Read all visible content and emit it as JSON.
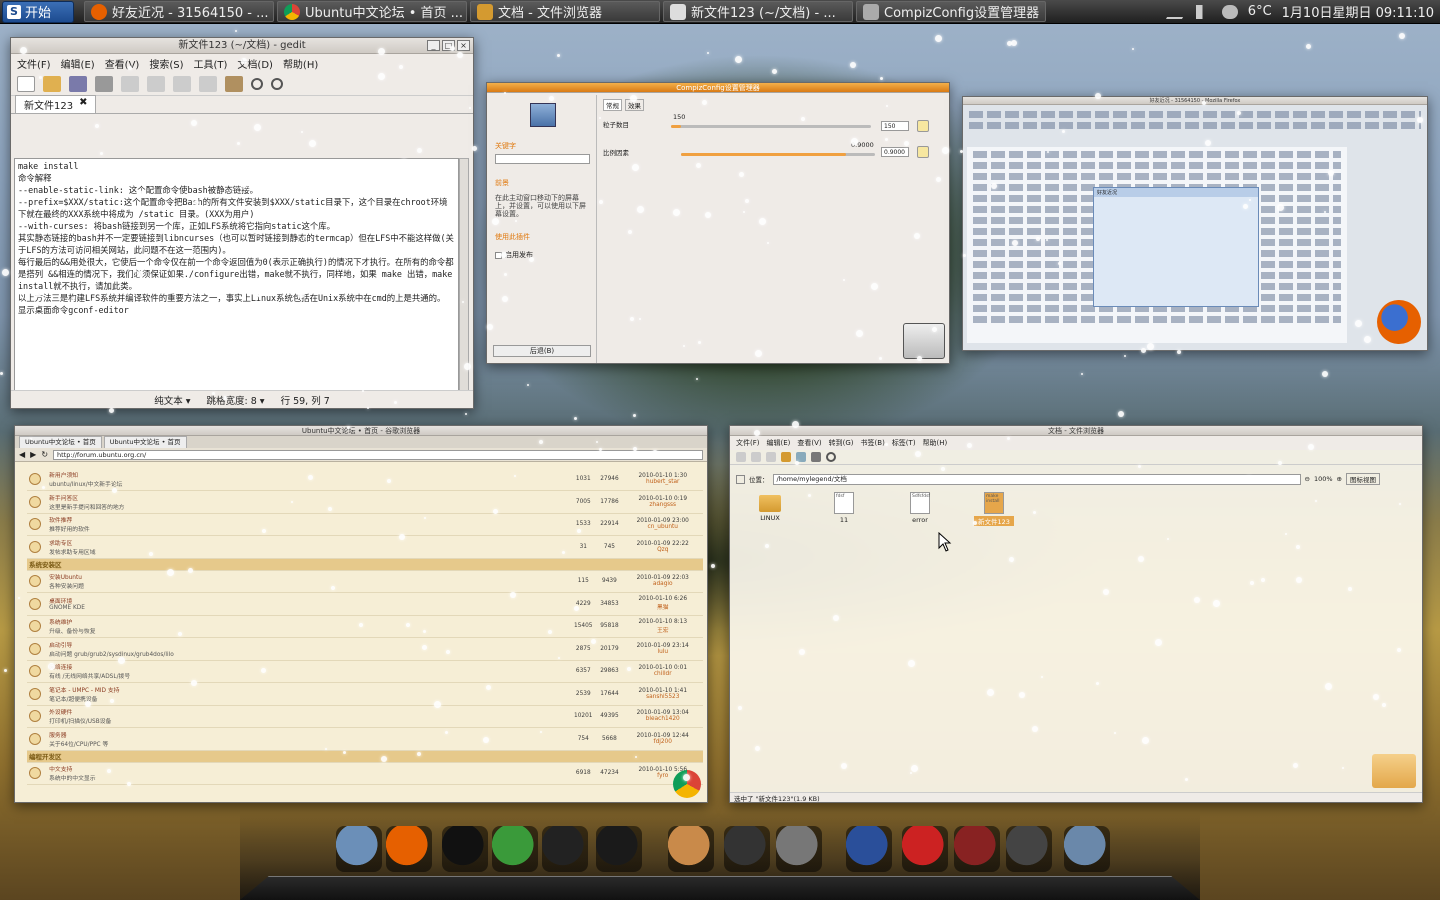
{
  "panel": {
    "start_label": "开始",
    "tasks": [
      {
        "label": "好友近况 - 31564150 - ...",
        "icon": "firefox-icon",
        "color": "#e66000"
      },
      {
        "label": "Ubuntu中文论坛 • 首页 ...",
        "icon": "chrome-icon",
        "color": "#3a8a3a"
      },
      {
        "label": "文档 - 文件浏览器",
        "icon": "folder-icon",
        "color": "#d49a30"
      },
      {
        "label": "新文件123 (~/文档) - ...",
        "icon": "text-editor-icon",
        "color": "#dddddd"
      },
      {
        "label": "CompizConfig设置管理器",
        "icon": "compiz-icon",
        "color": "#aaaaaa"
      }
    ],
    "weather": "6°C",
    "clock": "1月10日星期日 09:11:10"
  },
  "gedit": {
    "title": "新文件123 (~/文档) - gedit",
    "menu": [
      "文件(F)",
      "编辑(E)",
      "查看(V)",
      "搜索(S)",
      "工具(T)",
      "文档(D)",
      "帮助(H)"
    ],
    "tab_label": "新文件123",
    "lines": [
      "make install",
      "",
      "命令解释",
      "",
      "--enable-static-link: 这个配置命令使bash被静态链接。",
      "",
      "--prefix=$XXX/static:这个配置命令把Bash的所有文件安装到$XXX/static目录下，这个目录在chroot环境下就在最终的XXX系统中将成为 /static 目录。(XXX为用户)",
      "",
      "--with-curses: 将bash链接到另一个库，正如LFS系统将它指向static这个库。",
      "",
      "其实静态链接的bash并不一定要链接到libncurses（也可以暂时链接到静态的termcap）但在LFS中不能这样做(关于LFS的方法可访问相关网站，此问题不在这一范围内)。",
      "",
      "每行最后的&&用处很大，它使后一个命令仅在前一个命令返回值为0(表示正确执行)的情况下才执行。在所有的命令都是搭列 &&相连的情况下，我们必须保证如果./configure出错，make就不执行，同样地，如果 make 出错，make install就不执行，请加此类。",
      "",
      "以上方法三是构建LFS系统并编译软件的重要方法之一，事实上Linux系统包括在Unix系统中在cmd的上是共通的。",
      "",
      "",
      "显示桌面命令gconf-editor"
    ],
    "status": {
      "mode": "纯文本 ▾",
      "tab_width": "跳格宽度: 8 ▾",
      "position": "行 59, 列 7"
    }
  },
  "ccsm": {
    "title": "CompizConfig设置管理器",
    "search_label": "关键字",
    "category_label": "前景",
    "description": "在此主动窗口移动下的屏幕上，并设置，可以使用以下屏幕设置。",
    "filter_label": "使用此插件",
    "checkbox_label": "启用发布",
    "back_button": "后退(B)",
    "tabs": [
      "常规",
      "效果"
    ],
    "settings": [
      {
        "label": "粒子数目",
        "value": "150",
        "spin": "150",
        "fill": 0.05
      },
      {
        "label": "比例因素",
        "value": "0.9000",
        "spin": "0.9000",
        "fill": 0.85
      }
    ]
  },
  "firefox_thumb": {
    "title": "好友近况 - 31564150 - Mozilla Firefox",
    "popup_title": "好友近况"
  },
  "forum": {
    "title": "Ubuntu中文论坛 • 首页 - 谷歌浏览器",
    "tabs": [
      "Ubuntu中文论坛 • 首页",
      "Ubuntu中文论坛 • 首页"
    ],
    "url": "http://forum.ubuntu.org.cn/",
    "rows": [
      {
        "type": "row",
        "topic": "新用户须知",
        "desc": "ubuntu/linux/中文新手论坛",
        "topics": "1031",
        "posts": "27946",
        "date": "2010-01-10 1:30",
        "user": "hubert_star"
      },
      {
        "type": "row",
        "topic": "新手问答区",
        "desc": "这里是新手提问和回答的地方",
        "topics": "7005",
        "posts": "17786",
        "date": "2010-01-10 0:19",
        "user": "zhangsss"
      },
      {
        "type": "row",
        "topic": "软件推荐",
        "desc": "推荐好用的软件",
        "topics": "1533",
        "posts": "22914",
        "date": "2010-01-09 23:00",
        "user": "cn_ubuntu"
      },
      {
        "type": "row",
        "topic": "求助专区",
        "desc": "发帖求助专用区域",
        "topics": "31",
        "posts": "745",
        "date": "2010-01-09 22:22",
        "user": "Qzq"
      },
      {
        "type": "sec",
        "label": "系统安装区"
      },
      {
        "type": "row",
        "topic": "安装Ubuntu",
        "desc": "各种安装问题",
        "topics": "115",
        "posts": "9439",
        "date": "2010-01-09 22:03",
        "user": "adagio"
      },
      {
        "type": "row",
        "topic": "桌面环境",
        "desc": "GNOME KDE",
        "topics": "4229",
        "posts": "34853",
        "date": "2010-01-10 6:26",
        "user": "黑猫"
      },
      {
        "type": "row",
        "topic": "系统维护",
        "desc": "升级、备份与恢复",
        "topics": "15405",
        "posts": "95818",
        "date": "2010-01-10 8:13",
        "user": "王宏"
      },
      {
        "type": "row",
        "topic": "启动引导",
        "desc": "启动问题 grub/grub2/sysdinux/grub4dos/lilo",
        "topics": "2875",
        "posts": "20179",
        "date": "2010-01-09 23:14",
        "user": "lulu"
      },
      {
        "type": "row",
        "topic": "网络连接",
        "desc": "有线 /无线网络共享/ADSL/拨号",
        "topics": "6357",
        "posts": "29863",
        "date": "2010-01-10 0:01",
        "user": "chilldr"
      },
      {
        "type": "row",
        "topic": "笔记本 - UMPC - MID 支持",
        "desc": "笔记本/超便携设备",
        "topics": "2539",
        "posts": "17644",
        "date": "2010-01-10 1:41",
        "user": "sanshi5523"
      },
      {
        "type": "row",
        "topic": "外设硬件",
        "desc": "打印机/扫描仪/USB设备",
        "topics": "10201",
        "posts": "49395",
        "date": "2010-01-09 13:04",
        "user": "bleach1420"
      },
      {
        "type": "row",
        "topic": "服务器",
        "desc": "关于64位/CPU/PPC 等",
        "topics": "754",
        "posts": "5668",
        "date": "2010-01-09 12:44",
        "user": "fdj200"
      },
      {
        "type": "sec",
        "label": "编程开发区"
      },
      {
        "type": "row",
        "topic": "中文支持",
        "desc": "系统中的中文显示",
        "topics": "6918",
        "posts": "47234",
        "date": "2010-01-10 5:56",
        "user": "fyro"
      }
    ]
  },
  "files": {
    "title": "文档 - 文件浏览器",
    "menu": [
      "文件(F)",
      "编辑(E)",
      "查看(V)",
      "转到(G)",
      "书签(B)",
      "标签(T)",
      "帮助(H)"
    ],
    "location_label": "位置：",
    "location": "/home/mylegend/文档",
    "zoom": "100%",
    "view": "图标视图",
    "items": [
      {
        "name": "LINUX",
        "kind": "folder"
      },
      {
        "name": "11",
        "kind": "file",
        "preview": "fdsf"
      },
      {
        "name": "error",
        "kind": "file",
        "preview": "Sdfsfdsf"
      },
      {
        "name": "新文件123",
        "kind": "file-selected",
        "preview": "make install"
      }
    ],
    "status": "选中了 \"新文件123\"(1.9 KB)"
  },
  "dock": {
    "items": [
      {
        "name": "video-app-icon",
        "color": "#6b8fb8"
      },
      {
        "name": "firefox-icon",
        "color": "#e66000"
      },
      {
        "name": "qq-icon",
        "color": "#111111"
      },
      {
        "name": "chrome-icon",
        "color": "#3a9a3a"
      },
      {
        "name": "terminal-icon",
        "color": "#222222"
      },
      {
        "name": "amazon-icon",
        "color": "#1a1a1a"
      },
      {
        "name": "nautilus-shell-icon",
        "color": "#c98a4a"
      },
      {
        "name": "wiki-icon",
        "color": "#333333"
      },
      {
        "name": "settings-icon",
        "color": "#777777"
      },
      {
        "name": "workspace-switcher-icon",
        "color": "#2a4f9a"
      },
      {
        "name": "power-icon",
        "color": "#cc2222"
      },
      {
        "name": "monitor-icon",
        "color": "#882222"
      },
      {
        "name": "trash-icon",
        "color": "#444444"
      },
      {
        "name": "dock-folder-icon",
        "color": "#6a88aa"
      }
    ]
  }
}
